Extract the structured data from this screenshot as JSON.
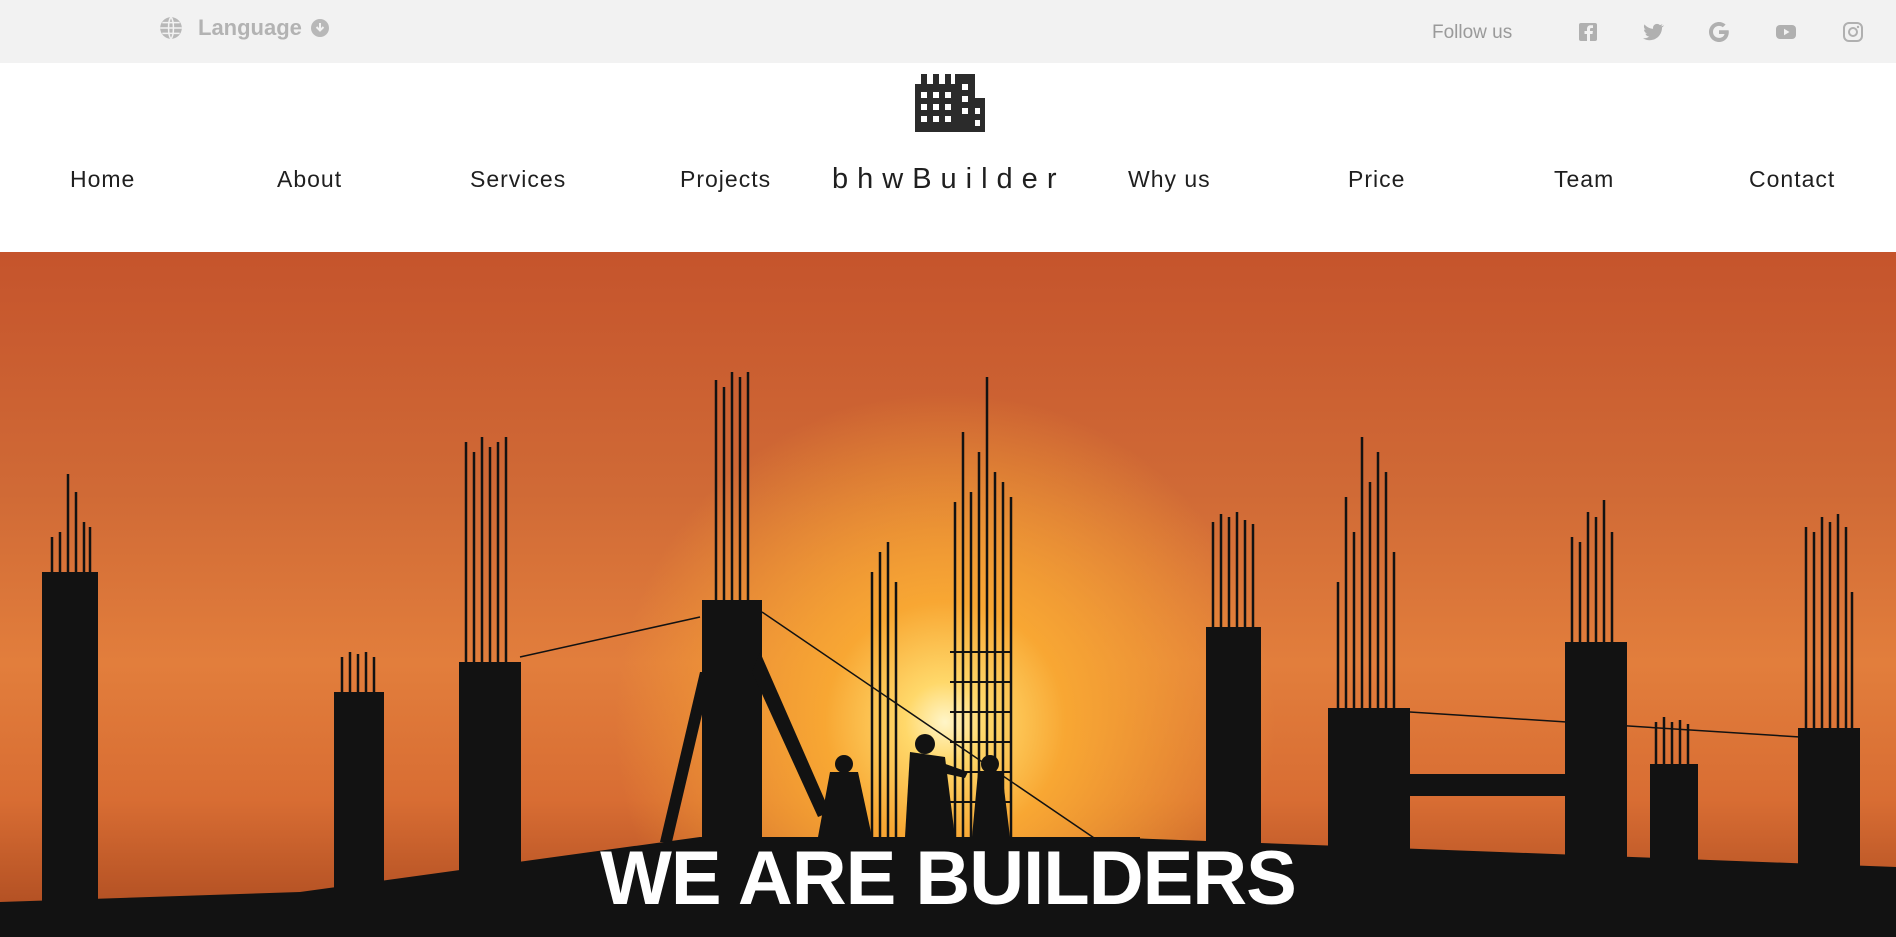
{
  "topbar": {
    "language_label": "Language",
    "language_icon": "globe-icon",
    "language_dropdown_icon": "download-circle-icon",
    "follow_label": "Follow us",
    "social_icons": [
      "facebook-icon",
      "twitter-icon",
      "google-icon",
      "youtube-icon",
      "instagram-icon"
    ]
  },
  "nav": {
    "logo_icon": "building-icon",
    "brand": "bhwBuilder",
    "items": [
      "Home",
      "About",
      "Services",
      "Projects",
      "Why us",
      "Price",
      "Team",
      "Contact"
    ]
  },
  "hero": {
    "title": "WE ARE BUILDERS"
  },
  "colors": {
    "topbar_bg": "#f2f2f2",
    "nav_text": "#1f1f1f",
    "sky": "#d06a36",
    "sun": "#ffd86a"
  }
}
